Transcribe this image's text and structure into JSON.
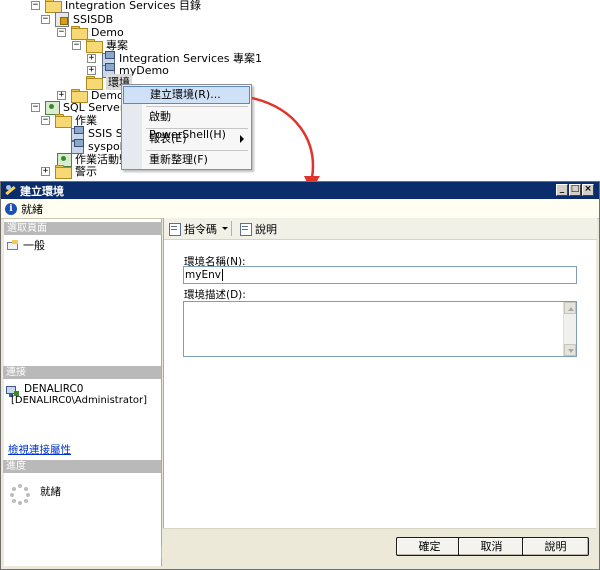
{
  "tree": {
    "root": "Integration Services 目錄",
    "ssisdb": "SSISDB",
    "demo": "Demo",
    "projects": "專案",
    "project1": "Integration Services 專案1",
    "mydemo": "myDemo",
    "environments": "環境",
    "demo2": "Demo2",
    "agent": "SQL Server Agen",
    "jobs": "作業",
    "job1": "SSIS Serv",
    "job2": "syspolicy",
    "activity": "作業活動監",
    "alerts": "警示"
  },
  "context_menu": {
    "items": [
      {
        "label": "建立環境(R)..."
      },
      {
        "label": "啟動 PowerShell(H)"
      },
      {
        "label": "報表(E)"
      },
      {
        "label": "重新整理(F)"
      }
    ]
  },
  "dialog": {
    "title": "建立環境",
    "status": "就緒",
    "left": {
      "select_page_header": "選取頁面",
      "pages": [
        {
          "label": "一般"
        }
      ],
      "connection_header": "連接",
      "server": "DENALIRC0",
      "login": "[DENALIRC0\\Administrator]",
      "view_connection_link": "檢視連接屬性",
      "progress_header": "進度",
      "progress_status": "就緒"
    },
    "toolbar": {
      "script_label": "指令碼",
      "help_label": "說明"
    },
    "form": {
      "name_label": "環境名稱(N):",
      "name_value": "myEnv",
      "desc_label": "環境描述(D):",
      "desc_value": ""
    },
    "buttons": {
      "ok": "確定",
      "cancel": "取消",
      "help": "說明"
    }
  },
  "colors": {
    "title_bar": "#0c2d6b",
    "arrow": "#e0332b",
    "highlight": "#cfe1f7",
    "link": "#0033cc"
  }
}
